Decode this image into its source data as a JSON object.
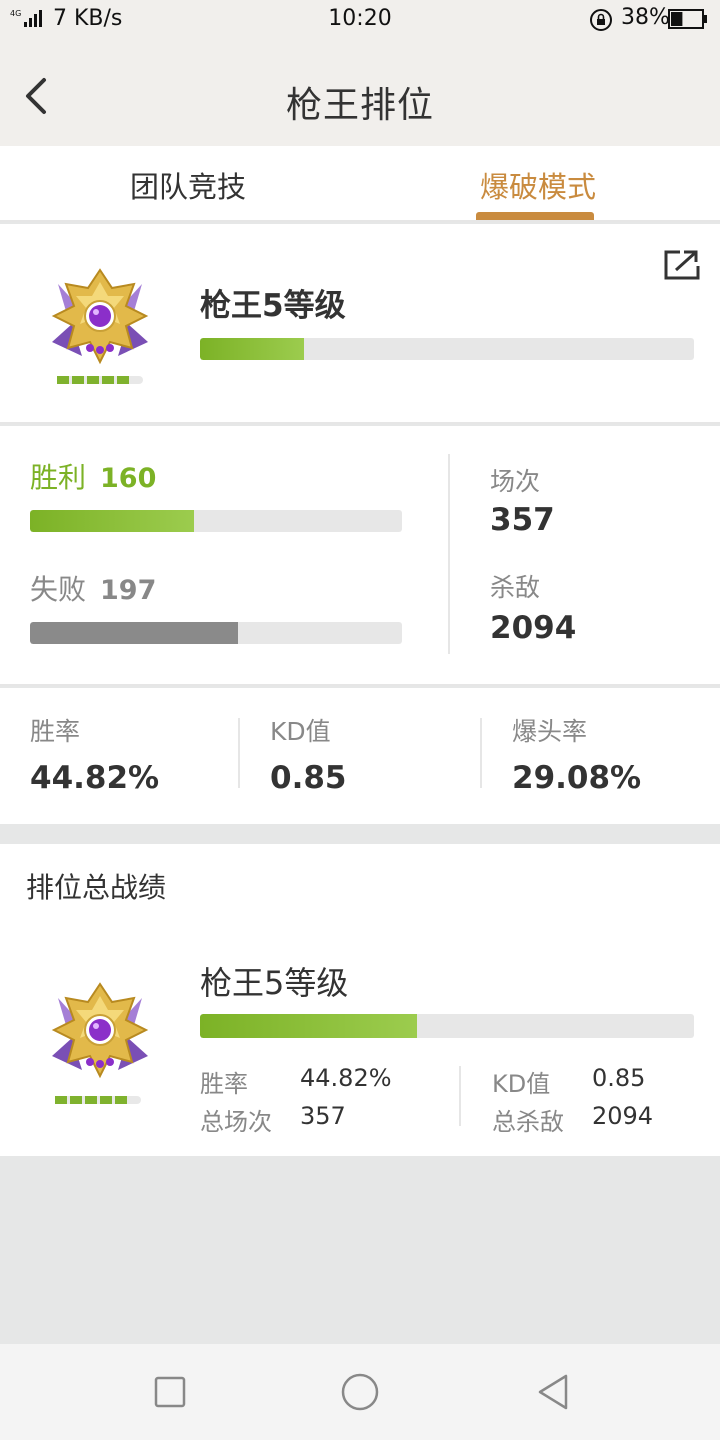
{
  "status_bar": {
    "network": "4G",
    "speed": "7 KB/s",
    "time": "10:20",
    "battery": "38%",
    "battery_level": 0.38,
    "icons": [
      "signal-icon",
      "rotation-lock-icon",
      "battery-icon"
    ]
  },
  "navbar": {
    "title": "枪王排位",
    "back_icon": "chevron-left-icon"
  },
  "tabs": [
    {
      "label": "团队竞技",
      "active": false
    },
    {
      "label": "爆破模式",
      "active": true
    }
  ],
  "colors": {
    "accent": "#c98b3f",
    "win_green": "#7cb226",
    "lose_gray": "#8a8a8a",
    "text": "#333333",
    "muted": "#888888"
  },
  "rank_card": {
    "rank_name": "枪王5等级",
    "progress": 0.21,
    "level_dots": 5,
    "share_icon": "share-icon",
    "badge_icon": "rank-badge-icon"
  },
  "record": {
    "win_label": "胜利",
    "win_value": "160",
    "win_fraction": 0.44,
    "lose_label": "失败",
    "lose_value": "197",
    "lose_fraction": 0.56,
    "matches_label": "场次",
    "matches_value": "357",
    "kills_label": "杀敌",
    "kills_value": "2094"
  },
  "rates": [
    {
      "label": "胜率",
      "value": "44.82%"
    },
    {
      "label": "KD值",
      "value": "0.85"
    },
    {
      "label": "爆头率",
      "value": "29.08%"
    }
  ],
  "total": {
    "title": "排位总战绩",
    "rank_name": "枪王5等级",
    "progress": 0.44,
    "win_rate_label": "胜率",
    "win_rate_value": "44.82%",
    "matches_label": "总场次",
    "matches_value": "357",
    "kd_label": "KD值",
    "kd_value": "0.85",
    "kills_label": "总杀敌",
    "kills_value": "2094"
  },
  "system_nav": [
    "recent-apps-icon",
    "home-icon",
    "back-triangle-icon"
  ]
}
